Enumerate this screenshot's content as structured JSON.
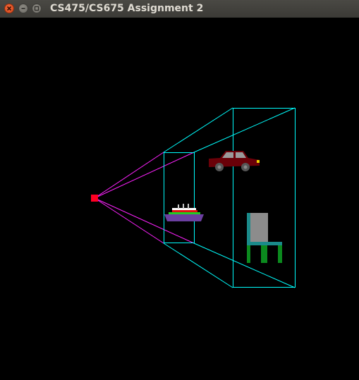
{
  "window": {
    "title": "CS475/CS675 Assignment 2",
    "buttons": {
      "close": "close",
      "minimize": "minimize",
      "maximize": "maximize"
    }
  },
  "scene": {
    "background": "#000000",
    "camera": {
      "color": "#ff0022"
    },
    "frustum": {
      "rays_color": "#ff22ff",
      "box_color": "#00ffff"
    },
    "objects": [
      "ship",
      "car",
      "chair"
    ],
    "colors": {
      "ship_hull": "#6b3fa0",
      "ship_deck_red": "#e01010",
      "ship_deck_green": "#22cc22",
      "ship_deck_white": "#ffffff",
      "car_body": "#6a0008",
      "car_window": "#9a9a9a",
      "wheel": "#555555",
      "chair_back": "#8c8c8c",
      "chair_frame": "#1a8a8a",
      "chair_leg": "#0b8a1e"
    }
  }
}
